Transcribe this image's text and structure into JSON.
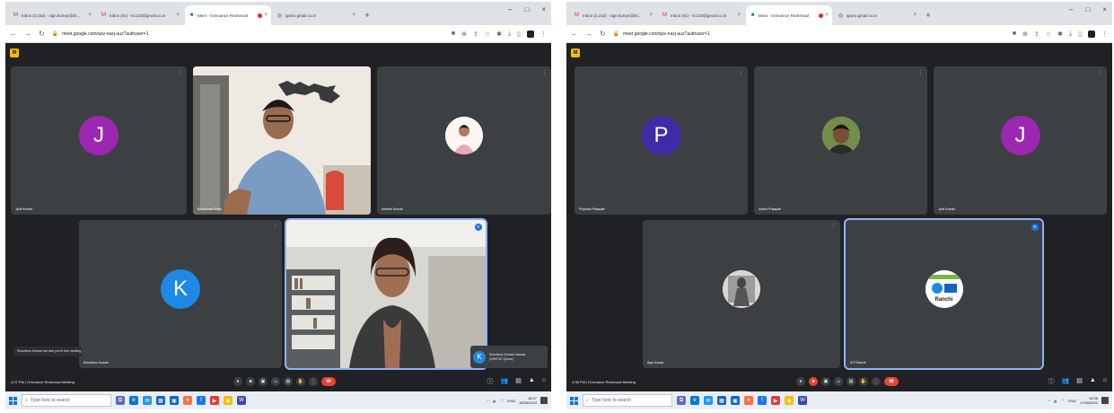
{
  "colors": {
    "meet_bg": "#202124",
    "tile_bg": "#3c4043",
    "hangup": "#ea4335",
    "active_border": "#8ab4f8"
  },
  "left": {
    "tabs": [
      {
        "title": "Inbox (2,152) - sign.kumar@iitr...",
        "icon": "gmail-icon",
        "active": false
      },
      {
        "title": "Inbox (61) - kc123@gmail.co.in",
        "icon": "gmail-icon",
        "active": false
      },
      {
        "title": "Meet - Grievance Redressal",
        "icon": "meet-icon",
        "active": true,
        "recording": true
      },
      {
        "title": "igram.gmail.co.in",
        "icon": "web-icon",
        "active": false
      }
    ],
    "url": "meet.google.com/quv-nazj-uuz?authuser=1",
    "tiles": [
      {
        "type": "avatar",
        "letter": "J",
        "color": "#9c27b0",
        "name": "Jyoti Kumari"
      },
      {
        "type": "video",
        "name": "Bhupendar Singh",
        "scene": "man"
      },
      {
        "type": "photo",
        "name": "Neelam Kumari",
        "scene": "woman-small"
      },
      {
        "type": "avatar",
        "letter": "K",
        "color": "#1e88e5",
        "name": "Khushboo Kumari"
      },
      {
        "type": "video",
        "name": "Khushboo Kumari Jaiswal",
        "scene": "woman",
        "speaking": true
      }
    ],
    "notice": "Khushboo Kumari can see you in this meeting",
    "presenter_badge": {
      "letter": "K",
      "name": "Khushboo Kumari Jaiswal",
      "sub": "(GRIEVE Queue)"
    },
    "meeting": {
      "time": "4:07 PM",
      "name": "Grievance Redressal Meeting"
    },
    "taskbar": {
      "search_placeholder": "Type here to search",
      "time": "16:07",
      "date": "15/08/2023"
    }
  },
  "right": {
    "tabs": [
      {
        "title": "Inbox (2,152) - sign.kumar@iitr...",
        "icon": "gmail-icon",
        "active": false
      },
      {
        "title": "Inbox (61) - kc123@gmail.co.in",
        "icon": "gmail-icon",
        "active": false
      },
      {
        "title": "Meet - Grievance Redressal",
        "icon": "meet-icon",
        "active": true,
        "recording": true
      },
      {
        "title": "igram.gmail.co.in",
        "icon": "web-icon",
        "active": false
      }
    ],
    "url": "meet.google.com/quv-nazj-uuz?authuser=1",
    "tiles": [
      {
        "type": "avatar",
        "letter": "P",
        "color": "#3f2aa8",
        "name": "Priyanka Prajapati"
      },
      {
        "type": "photo",
        "name": "Anand Prajapati",
        "scene": "man-small"
      },
      {
        "type": "avatar",
        "letter": "J",
        "color": "#9c27b0",
        "name": "Jyoti Kumari"
      },
      {
        "type": "photo",
        "name": "Ajay Kumar",
        "scene": "statue"
      },
      {
        "type": "photo",
        "name": "ICT Ranchi",
        "scene": "logo",
        "logo_text": "Ranchi",
        "active": true
      }
    ],
    "meeting": {
      "time": "4:38 PM",
      "name": "Grievance Redressal Meeting"
    },
    "taskbar": {
      "search_placeholder": "Type here to search",
      "time": "16:38",
      "date": "17/08/2023"
    }
  }
}
